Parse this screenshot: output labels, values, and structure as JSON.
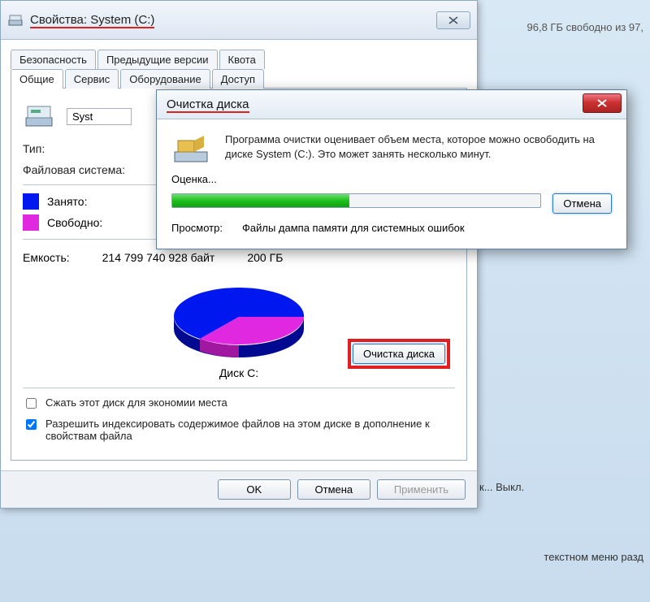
{
  "background": {
    "free_space_text": "96,8 ГБ свободно из 97,",
    "mid_text": "к...  Выкл.",
    "bottom_text": "текстном меню разд"
  },
  "props": {
    "title_prefix": "Свойства: ",
    "title_drive": "System (C:)",
    "tabs_top": [
      "Безопасность",
      "Предыдущие версии",
      "Квота"
    ],
    "tabs_bottom": [
      "Общие",
      "Сервис",
      "Оборудование",
      "Доступ"
    ],
    "drive_name_value": "Syst",
    "type_label": "Тип:",
    "fs_label": "Файловая система:",
    "used_label": "Занято:",
    "free_label": "Свободно:",
    "capacity_label": "Емкость:",
    "capacity_bytes": "214 799 740 928 байт",
    "capacity_gb": "200 ГБ",
    "disk_label": "Диск C:",
    "cleanup_btn": "Очистка диска",
    "compress_label": "Сжать этот диск для экономии места",
    "index_label": "Разрешить индексировать содержимое файлов на этом диске в дополнение к свойствам файла",
    "ok": "OK",
    "cancel": "Отмена",
    "apply": "Применить"
  },
  "cleanup": {
    "title": "Очистка диска",
    "message": "Программа очистки оценивает объем места, которое можно освободить на диске System (C:). Это может занять несколько минут.",
    "evaluating": "Оценка...",
    "cancel": "Отмена",
    "scan_label": "Просмотр:",
    "scan_value": "Файлы дампа памяти для системных ошибок"
  },
  "chart_data": {
    "type": "pie",
    "title": "Диск C:",
    "series": [
      {
        "name": "Занято",
        "value": 150,
        "color": "#0018f0"
      },
      {
        "name": "Свободно",
        "value": 50,
        "color": "#e028e0"
      }
    ],
    "total_label": "200 ГБ",
    "total_bytes": "214 799 740 928 байт"
  }
}
